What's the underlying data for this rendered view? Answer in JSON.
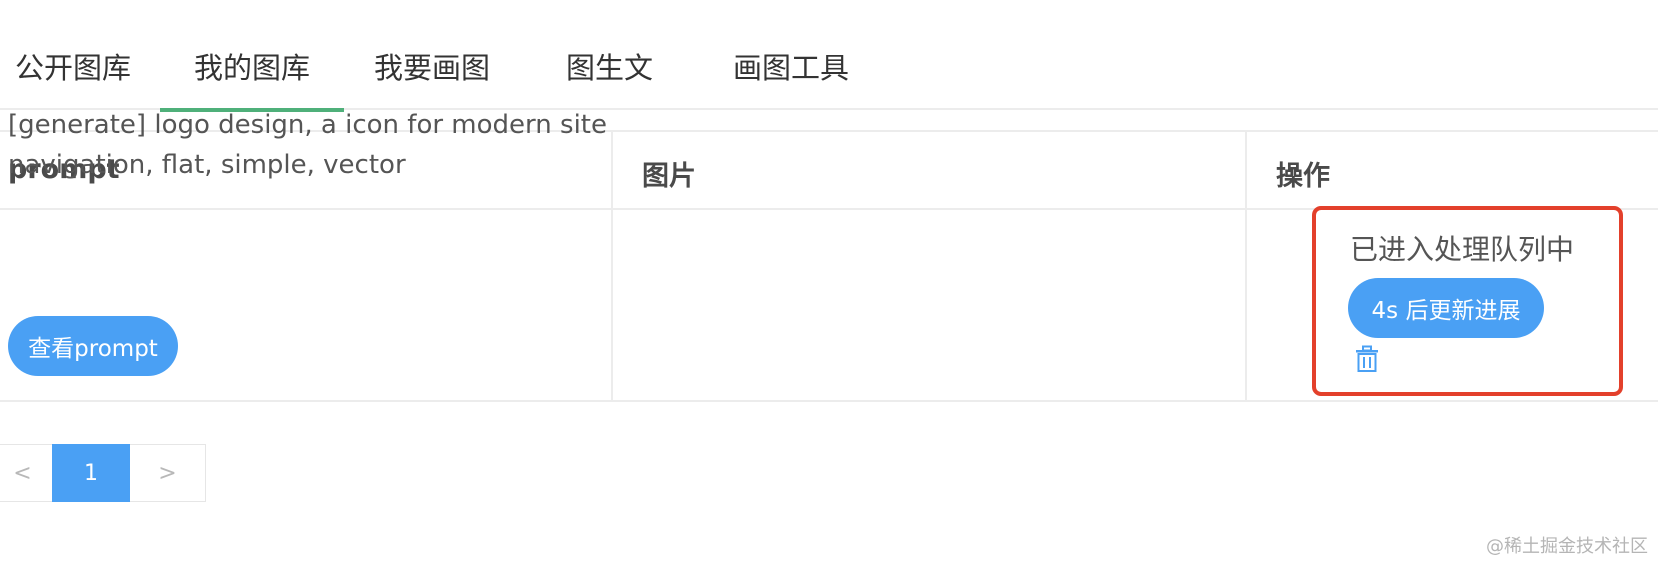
{
  "tabs": [
    {
      "label": "公开图库",
      "active": false
    },
    {
      "label": "我的图库",
      "active": true
    },
    {
      "label": "我要画图",
      "active": false
    },
    {
      "label": "图生文",
      "active": false
    },
    {
      "label": "画图工具",
      "active": false
    }
  ],
  "table": {
    "headers": {
      "prompt": "prompt",
      "image": "图片",
      "action": "操作"
    },
    "rows": [
      {
        "prompt": "[generate] logo design, a icon for modern site navigation, flat, simple, vector",
        "view_button": "查看prompt",
        "image": "",
        "status": "已进入处理队列中",
        "update_button": "4s 后更新进展",
        "delete_icon": "trash-icon"
      }
    ]
  },
  "pagination": {
    "prev": "<",
    "current": "1",
    "next": ">"
  },
  "watermark": "@稀土掘金技术社区",
  "colors": {
    "accent": "#4aa0f4",
    "active_tab_underline": "#4fb07a",
    "highlight_box": "#e3402b"
  }
}
